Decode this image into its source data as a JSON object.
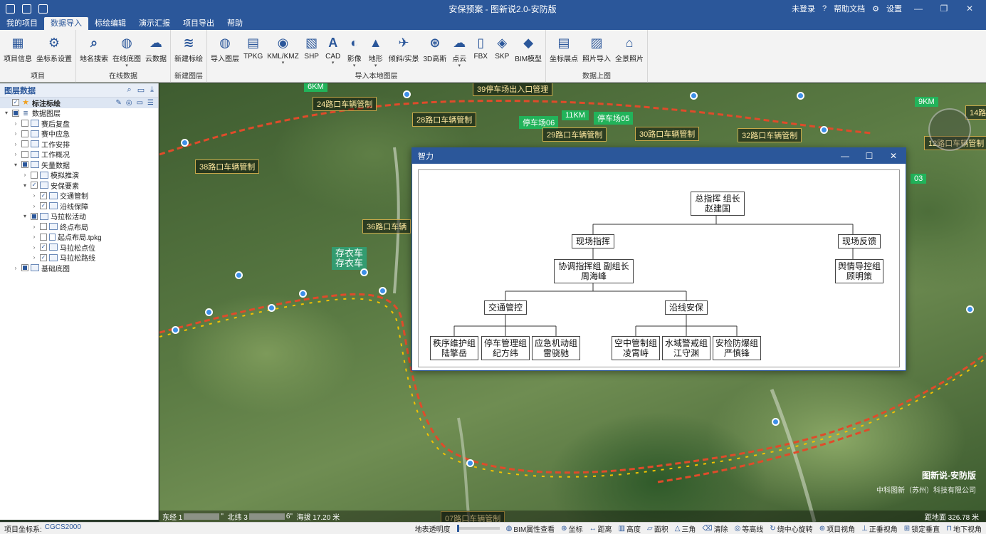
{
  "window": {
    "title": "安保预案 - 图新说2.0-安防版",
    "login": "未登录",
    "help": "帮助文档",
    "settings": "设置"
  },
  "menu": [
    "我的项目",
    "数据导入",
    "标绘编辑",
    "演示汇报",
    "项目导出",
    "帮助"
  ],
  "ribbon": {
    "groups": [
      {
        "label": "项目",
        "buttons": [
          {
            "label": "项目信息",
            "icon": "project-info-icon",
            "glyph": "▦"
          },
          {
            "label": "坐标系设置",
            "icon": "coord-settings-icon",
            "glyph": "⚙"
          }
        ]
      },
      {
        "label": "在线数据",
        "buttons": [
          {
            "label": "地名搜索",
            "icon": "place-search-icon",
            "glyph": "⌕"
          },
          {
            "label": "在线底图",
            "icon": "online-basemap-icon",
            "glyph": "◍",
            "caret": true
          },
          {
            "label": "云数据",
            "icon": "cloud-data-icon",
            "glyph": "☁"
          }
        ]
      },
      {
        "label": "新建图层",
        "buttons": [
          {
            "label": "新建标绘",
            "icon": "new-layer-icon",
            "glyph": "≋"
          }
        ]
      },
      {
        "label": "导入本地图层",
        "buttons": [
          {
            "label": "导入图层",
            "icon": "import-layer-icon",
            "glyph": "◍"
          },
          {
            "label": "TPKG",
            "icon": "tpkg-icon",
            "glyph": "▤"
          },
          {
            "label": "KML/KMZ",
            "icon": "kml-icon",
            "glyph": "◉",
            "caret": true
          },
          {
            "label": "SHP",
            "icon": "shp-icon",
            "glyph": "▧"
          },
          {
            "label": "CAD",
            "icon": "cad-icon",
            "glyph": "A",
            "caret": true
          },
          {
            "label": "影像",
            "icon": "imagery-icon",
            "glyph": "◐",
            "caret": true
          },
          {
            "label": "地形",
            "icon": "terrain-icon",
            "glyph": "▲",
            "caret": true
          },
          {
            "label": "倾斜/实景",
            "icon": "oblique-icon",
            "glyph": "✈"
          },
          {
            "label": "3D高斯",
            "icon": "gaussian-icon",
            "glyph": "⊛"
          },
          {
            "label": "点云",
            "icon": "pointcloud-icon",
            "glyph": "☁",
            "caret": true
          },
          {
            "label": "FBX",
            "icon": "fbx-icon",
            "glyph": "▯"
          },
          {
            "label": "SKP",
            "icon": "skp-icon",
            "glyph": "◈"
          },
          {
            "label": "BIM模型",
            "icon": "bim-icon",
            "glyph": "◆"
          }
        ]
      },
      {
        "label": "数据上图",
        "buttons": [
          {
            "label": "坐标展点",
            "icon": "coord-points-icon",
            "glyph": "▤"
          },
          {
            "label": "照片导入",
            "icon": "photo-import-icon",
            "glyph": "▨"
          },
          {
            "label": "全景照片",
            "icon": "panorama-icon",
            "glyph": "⌂"
          }
        ]
      }
    ]
  },
  "layer_panel": {
    "title": "图层数据",
    "items": [
      {
        "label": "标注标绘",
        "level": 0,
        "exp": "",
        "check": "✓",
        "icon": "star",
        "bold": true,
        "selected": true
      },
      {
        "label": "数据图层",
        "level": 0,
        "exp": "▾",
        "check": "part",
        "icon": "db"
      },
      {
        "label": "赛后复盘",
        "level": 1,
        "exp": "›",
        "check": "",
        "icon": "folder"
      },
      {
        "label": "赛中应急",
        "level": 1,
        "exp": "›",
        "check": "",
        "icon": "folder"
      },
      {
        "label": "工作安排",
        "level": 1,
        "exp": "›",
        "check": "",
        "icon": "folder"
      },
      {
        "label": "工作概况",
        "level": 1,
        "exp": "›",
        "check": "",
        "icon": "folder"
      },
      {
        "label": "矢量数据",
        "level": 1,
        "exp": "▾",
        "check": "part",
        "icon": "folder"
      },
      {
        "label": "模拟推演",
        "level": 2,
        "exp": "›",
        "check": "",
        "icon": "folder"
      },
      {
        "label": "安保要素",
        "level": 2,
        "exp": "▾",
        "check": "✓",
        "icon": "folder"
      },
      {
        "label": "交通管制",
        "level": 3,
        "exp": "›",
        "check": "✓",
        "icon": "folder"
      },
      {
        "label": "沿线保障",
        "level": 3,
        "exp": "›",
        "check": "✓",
        "icon": "folder"
      },
      {
        "label": "马拉松活动",
        "level": 2,
        "exp": "▾",
        "check": "part",
        "icon": "folder"
      },
      {
        "label": "终点布局",
        "level": 3,
        "exp": "›",
        "check": "",
        "icon": "folder"
      },
      {
        "label": "起点布局.tpkg",
        "level": 3,
        "exp": "›",
        "check": "",
        "icon": "file"
      },
      {
        "label": "马拉松点位",
        "level": 3,
        "exp": "›",
        "check": "✓",
        "icon": "folder"
      },
      {
        "label": "马拉松路线",
        "level": 3,
        "exp": "›",
        "check": "✓",
        "icon": "folder"
      },
      {
        "label": "基础底图",
        "level": 1,
        "exp": "›",
        "check": "part",
        "icon": "folder"
      }
    ]
  },
  "map": {
    "labels": [
      {
        "text": "6KM",
        "style": "green"
      },
      {
        "text": "24路口车辆管制",
        "style": "yellow"
      },
      {
        "text": "39停车场出入口管理",
        "style": "yellow"
      },
      {
        "text": "28路口车辆管制",
        "style": "yellow"
      },
      {
        "text": "停车场06",
        "style": "green"
      },
      {
        "text": "11KM",
        "style": "green"
      },
      {
        "text": "停车场05",
        "style": "green"
      },
      {
        "text": "29路口车辆管制",
        "style": "yellow"
      },
      {
        "text": "30路口车辆管制",
        "style": "yellow"
      },
      {
        "text": "32路口车辆管制",
        "style": "yellow"
      },
      {
        "text": "9KM",
        "style": "green"
      },
      {
        "text": "14路",
        "style": "yellow"
      },
      {
        "text": "12路口车辆管制",
        "style": "yellow"
      },
      {
        "text": "38路口车辆管制",
        "style": "yellow"
      },
      {
        "text": "36路口车辆",
        "style": "yellow"
      },
      {
        "text": "03",
        "style": "green"
      },
      {
        "text": "07路口车辆管制",
        "style": "yellow"
      }
    ],
    "storage_label": [
      "存衣车",
      "存衣车"
    ],
    "brand_title": "图新说-安防版",
    "brand_sub": "中科图新（苏州）科技有限公司",
    "coord_east": "东经 1",
    "coord_east_tail": "\"",
    "coord_north": "北纬 3",
    "coord_north_tail": "6\"",
    "altitude": "海拔 17.20 米",
    "distance": "距地面 326.78 米"
  },
  "dialog": {
    "title": "智力",
    "org": {
      "root": [
        "总指挥 组长",
        "赵建国"
      ],
      "onsite": "现场指挥",
      "feedback": "现场反馈",
      "coord": [
        "协调指挥组 副组长",
        "周海峰"
      ],
      "opinion": [
        "舆情导控组",
        "顾明策"
      ],
      "traffic": "交通管控",
      "route": "沿线安保",
      "leaf": [
        [
          "秩序维护组",
          "陆擎岳"
        ],
        [
          "停车管理组",
          "纪方纬"
        ],
        [
          "应急机动组",
          "雷骁驰"
        ],
        [
          "空中管制组",
          "凌霄峙"
        ],
        [
          "水域警戒组",
          "江守渊"
        ],
        [
          "安检防爆组",
          "严慎锋"
        ]
      ]
    }
  },
  "statusbar": {
    "coord_label": "项目坐标系:",
    "coord_value": "CGCS2000",
    "opacity": "地表透明度",
    "tools": [
      "BIM属性查看",
      "坐标",
      "距离",
      "高度",
      "面积",
      "三角",
      "清除",
      "等高线",
      "绕中心旋转",
      "项目视角",
      "正垂视角",
      "锁定垂直",
      "地下视角"
    ]
  },
  "colors": {
    "primary": "#2b579a",
    "route_red": "#e04b2a",
    "route_yellow": "#f2c200"
  }
}
